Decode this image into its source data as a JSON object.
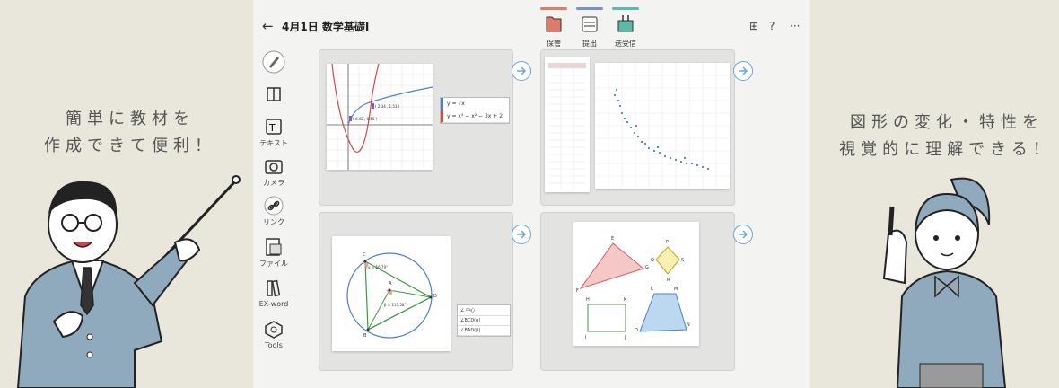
{
  "captions": {
    "left_line1": "簡単に教材を",
    "left_line2": "作成できて便利！",
    "right_line1": "図形の変化・特性を",
    "right_line2": "視覚的に理解できる！"
  },
  "app": {
    "title": "4月1日 数学基礎I",
    "toolbar": [
      {
        "label": "保管",
        "color": "#e07a6a"
      },
      {
        "label": "提出",
        "color": "#7a8fd0"
      },
      {
        "label": "送受信",
        "color": "#5cb8a8"
      }
    ],
    "right_icons": [
      "present-icon",
      "help-icon",
      "more-icon"
    ],
    "sidebar": [
      {
        "label": "",
        "icon": "pen-icon"
      },
      {
        "label": "",
        "icon": "layout-icon"
      },
      {
        "label": "テキスト",
        "icon": "text-icon"
      },
      {
        "label": "カメラ",
        "icon": "camera-icon"
      },
      {
        "label": "リンク",
        "icon": "link-icon"
      },
      {
        "label": "ファイル",
        "icon": "file-icon"
      },
      {
        "label": "EX-word",
        "icon": "book-icon"
      },
      {
        "label": "Tools",
        "icon": "tools-icon"
      }
    ]
  },
  "cards": {
    "graph": {
      "point1": "( 0.42 , 0.65 )",
      "point2": "( 2.34 , 1.53 )",
      "eq1": "y = √x",
      "eq2": "y = x³ − x² − 3x + 2"
    },
    "circle": {
      "labels": [
        "C",
        "A",
        "B",
        "D"
      ],
      "angle1": "α = 56.79°",
      "angle2": "β = 113.58°",
      "panel": [
        "∠ 中心",
        "∠BCD(α)",
        "∠BAD(β)"
      ]
    },
    "shapes": {
      "labels": [
        "E",
        "F",
        "G",
        "P",
        "Q",
        "R",
        "S",
        "H",
        "K",
        "I",
        "J",
        "L",
        "M",
        "O",
        "N"
      ]
    }
  }
}
